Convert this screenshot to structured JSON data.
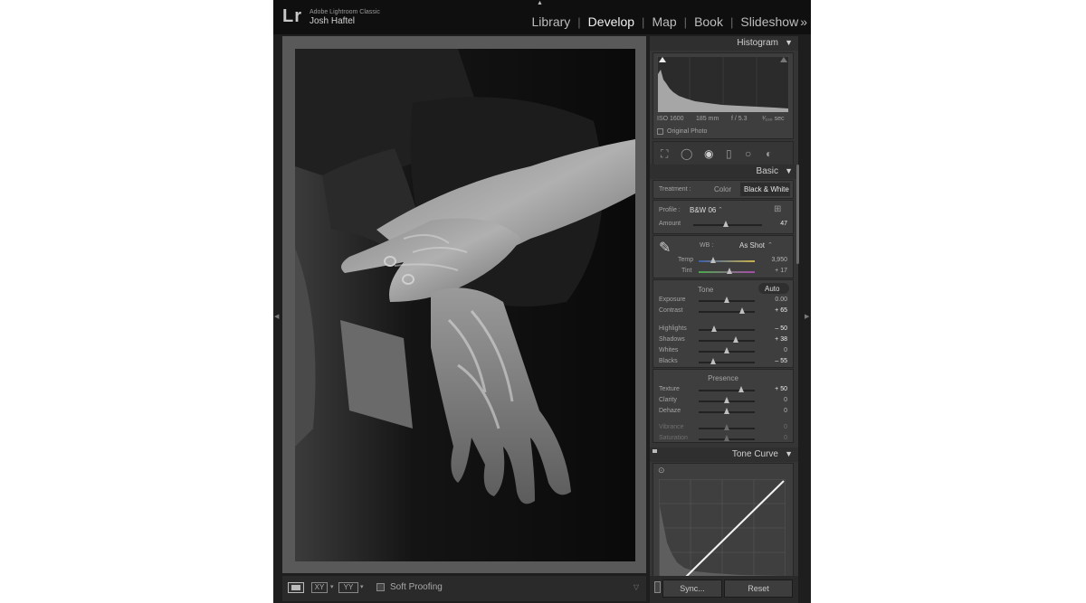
{
  "app": {
    "logo": "Lr",
    "name": "Adobe Lightroom Classic",
    "user": "Josh Haftel"
  },
  "modules": {
    "items": [
      {
        "label": "Library",
        "active": false
      },
      {
        "label": "Develop",
        "active": true
      },
      {
        "label": "Map",
        "active": false
      },
      {
        "label": "Book",
        "active": false
      },
      {
        "label": "Slideshow",
        "active": false
      }
    ],
    "more": "»"
  },
  "histogram": {
    "title": "Histogram",
    "iso": "ISO 1600",
    "focal": "185 mm",
    "aperture": "f / 5.3",
    "shutter": "¹⁄₁₀₀ sec",
    "original_photo": "Original Photo",
    "original_photo_checked": false
  },
  "tools": [
    "crop-icon",
    "spot-removal-icon",
    "red-eye-icon",
    "graduated-filter-icon",
    "radial-filter-icon",
    "adjustment-brush-icon"
  ],
  "basic": {
    "title": "Basic",
    "treatment_label": "Treatment :",
    "treatment_color": "Color",
    "treatment_bw": "Black & White",
    "profile_label": "Profile :",
    "profile_value": "B&W 06",
    "amount_label": "Amount",
    "amount_value": "47",
    "amount_level": 0.47,
    "wb_label": "WB :",
    "wb_value": "As Shot",
    "temp": {
      "label": "Temp",
      "value": "3,950",
      "level": 0.25
    },
    "tint": {
      "label": "Tint",
      "value": "+ 17",
      "level": 0.55
    },
    "tone_label": "Tone",
    "auto_label": "Auto",
    "tone_sliders": [
      {
        "label": "Exposure",
        "value": "0.00",
        "level": 0.5,
        "bright": false
      },
      {
        "label": "Contrast",
        "value": "+ 65",
        "level": 0.78,
        "bright": true
      },
      {
        "label": "Highlights",
        "value": "– 50",
        "level": 0.28,
        "bright": true
      },
      {
        "label": "Shadows",
        "value": "+ 38",
        "level": 0.66,
        "bright": true
      },
      {
        "label": "Whites",
        "value": "0",
        "level": 0.5,
        "bright": false
      },
      {
        "label": "Blacks",
        "value": "– 55",
        "level": 0.25,
        "bright": true
      }
    ],
    "presence_label": "Presence",
    "presence_sliders": [
      {
        "label": "Texture",
        "value": "+ 50",
        "level": 0.75,
        "bright": true
      },
      {
        "label": "Clarity",
        "value": "0",
        "level": 0.5,
        "bright": false
      },
      {
        "label": "Dehaze",
        "value": "0",
        "level": 0.5,
        "bright": false
      }
    ],
    "color_sliders": [
      {
        "label": "Vibrance",
        "value": "0",
        "level": 0.5
      },
      {
        "label": "Saturation",
        "value": "0",
        "level": 0.5
      }
    ]
  },
  "tone_curve": {
    "title": "Tone Curve"
  },
  "toolbar": {
    "compare_icon": "XY",
    "survey_icon": "YY",
    "soft_proofing": "Soft Proofing",
    "soft_proofing_checked": false
  },
  "footer": {
    "sync": "Sync...",
    "reset": "Reset"
  },
  "colors": {
    "panel": "#353535",
    "section": "#3e3e3e",
    "background": "#1e1e1e",
    "topbar": "#0f0f0f",
    "canvas": "#595959"
  }
}
